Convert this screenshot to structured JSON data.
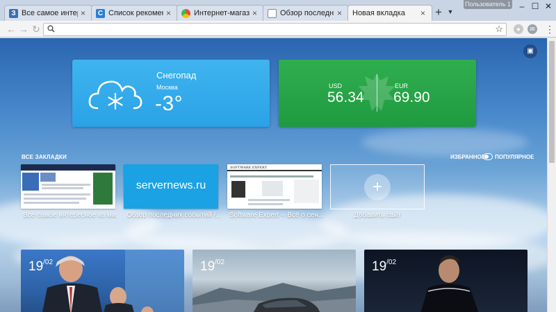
{
  "tabs": [
    {
      "title": "Все самое интересное и",
      "favicon_color": "#3b6fb6",
      "favicon_glyph": "З"
    },
    {
      "title": "Список рекомендовани",
      "favicon_color": "#2a7fd4",
      "favicon_glyph": "C"
    },
    {
      "title": "Интернет-магазин Chro",
      "favicon_color": "#e0a020",
      "favicon_glyph": ""
    },
    {
      "title": "Обзор последних событ",
      "favicon_color": "#ffffff",
      "favicon_glyph": ""
    },
    {
      "title": "Новая вкладка",
      "favicon_color": "",
      "favicon_glyph": ""
    }
  ],
  "window": {
    "user_label": "Пользователь 1"
  },
  "omnibox": {
    "value": "",
    "placeholder": ""
  },
  "weather": {
    "condition": "Снегопад",
    "city": "Москва",
    "temperature": "-3°"
  },
  "currency": {
    "usd_label": "USD",
    "usd_value": "56.34",
    "eur_label": "EUR",
    "eur_value": "69.90"
  },
  "bookmarks": {
    "section_title": "ВСЕ ЗАКЛАДКИ",
    "toggle_left": "ИЗБРАННОЕ",
    "toggle_right": "ПОПУЛЯРНОЕ",
    "items": [
      {
        "caption": "Все самое интересное из ми..."
      },
      {
        "caption": "Обзор последних событий /...",
        "tile_text": "servernews.ru"
      },
      {
        "caption": "Software Expert -- Всё о сен...",
        "tile_text": "SOFTWARE EXPERT"
      },
      {
        "caption": "Добавить сайт"
      }
    ]
  },
  "news": [
    {
      "day": "19",
      "month": "02"
    },
    {
      "day": "19",
      "month": "02"
    },
    {
      "day": "19",
      "month": "02"
    }
  ],
  "colors": {
    "weather_bg": "#2aa2e6",
    "currency_bg": "#1f9a40",
    "servernews_bg": "#1aa2e4"
  }
}
